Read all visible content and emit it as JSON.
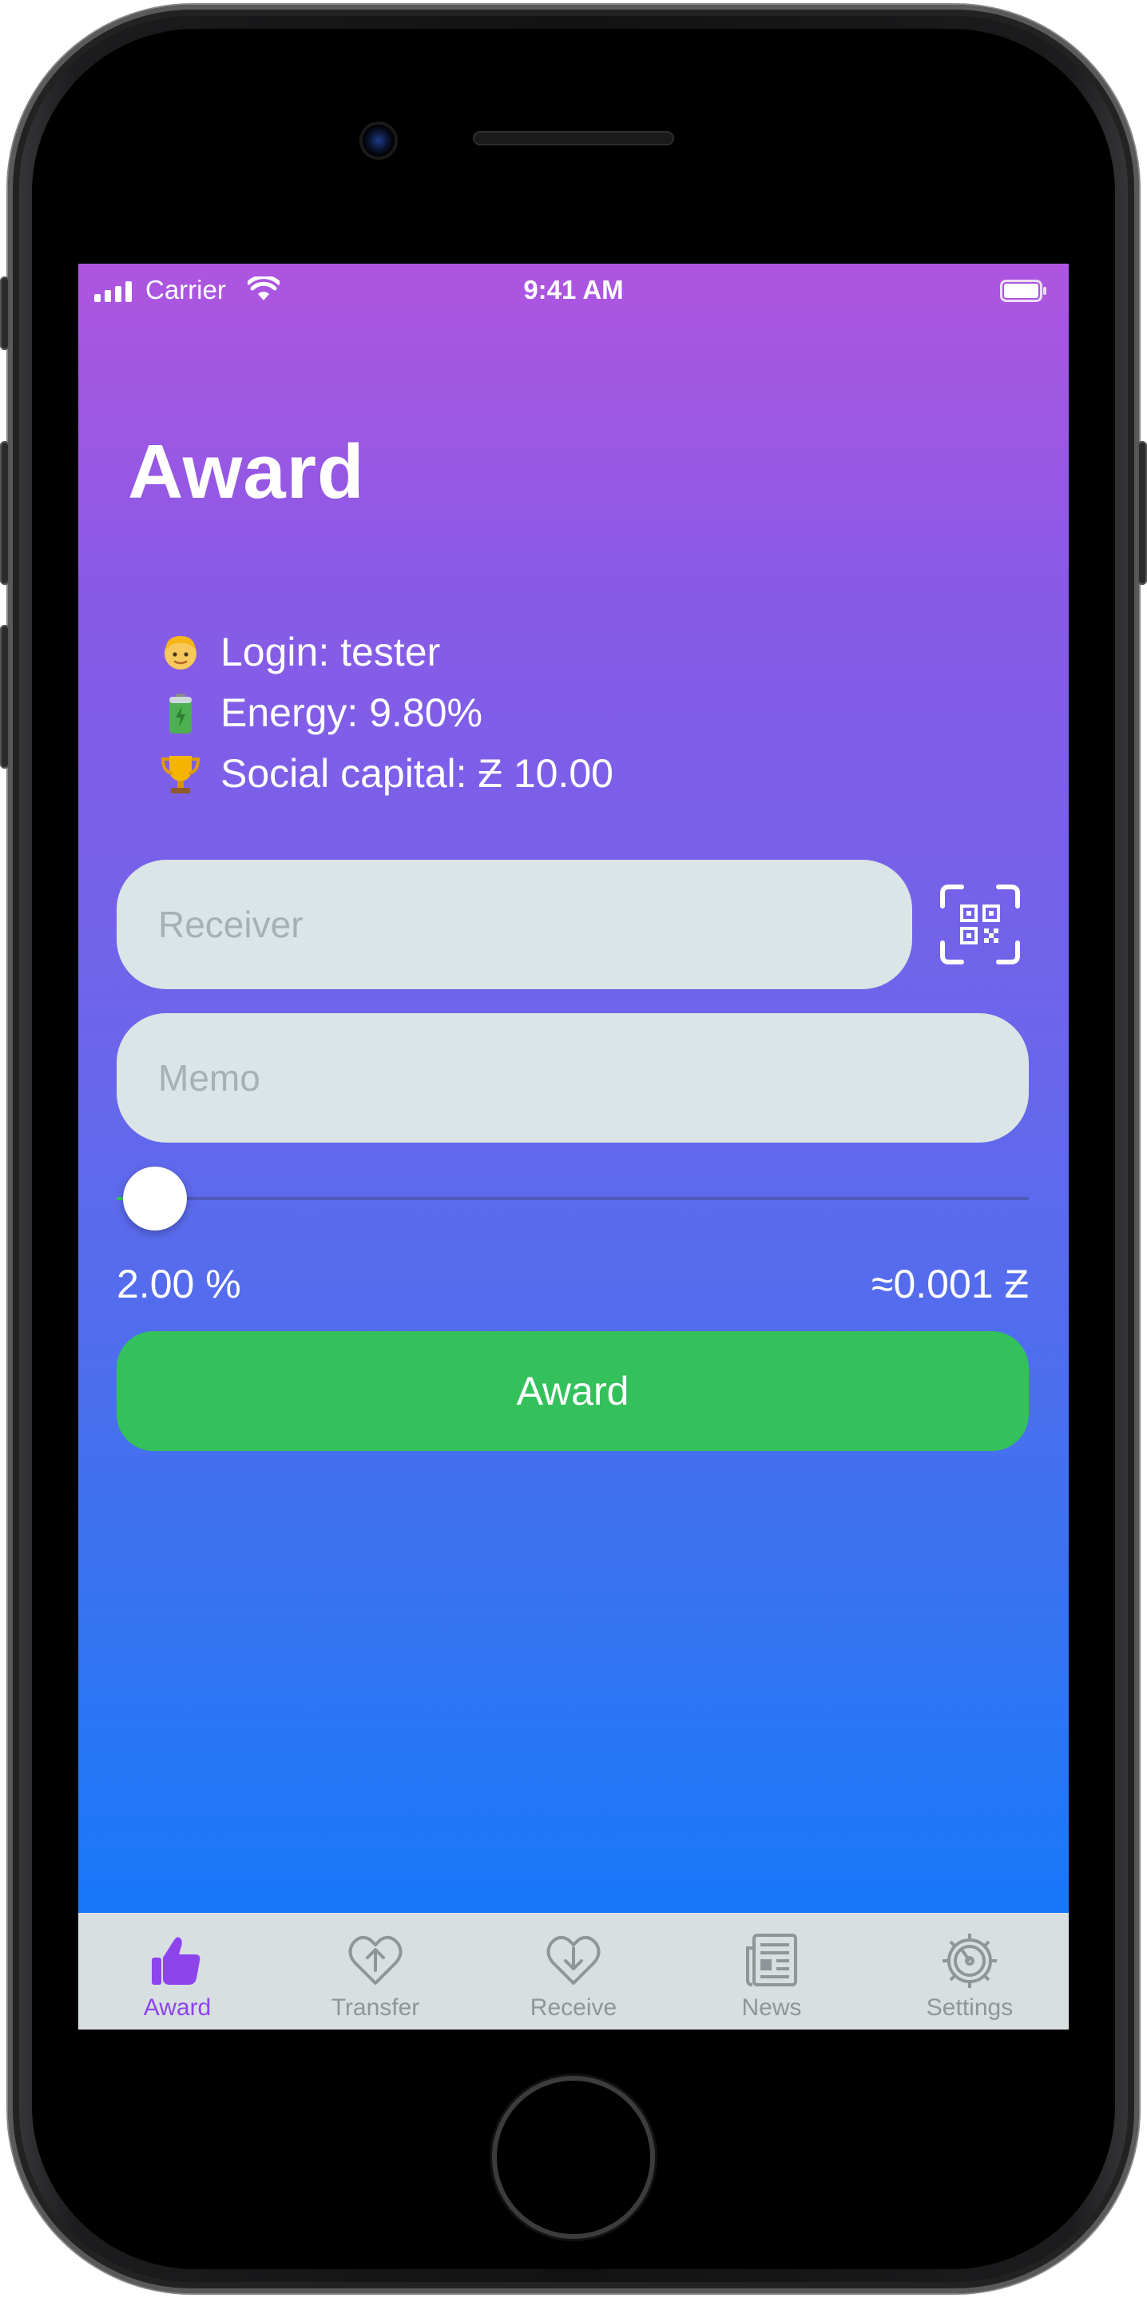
{
  "colors": {
    "gradient_top": "#ae55e0",
    "gradient_bottom": "#0b7bfb",
    "accent_purple": "#8e44ec",
    "award_green": "#34c15c",
    "field_bg": "#dbe4e6",
    "tab_bar_bg": "#d8dfe1",
    "tab_inactive": "#8e9699"
  },
  "status_bar": {
    "carrier": "Carrier",
    "time": "9:41 AM",
    "icons": [
      "signal-icon",
      "wifi-icon",
      "battery-icon"
    ]
  },
  "header": {
    "title": "Award"
  },
  "info": {
    "login": {
      "icon": "person-emoji-icon",
      "text": "Login: tester"
    },
    "energy": {
      "icon": "battery-emoji-icon",
      "text": "Energy: 9.80%"
    },
    "capital": {
      "icon": "trophy-emoji-icon",
      "text": "Social capital: Ƶ 10.00"
    }
  },
  "form": {
    "receiver": {
      "placeholder": "Receiver",
      "value": ""
    },
    "memo": {
      "placeholder": "Memo",
      "value": ""
    },
    "qr_icon": "qr-scan-icon",
    "slider_value": 0.0,
    "percent_text": "2.00 %",
    "approx_text": "≈0.001 Ƶ",
    "submit_label": "Award"
  },
  "tabs": [
    {
      "label": "Award",
      "icon": "thumbs-up-icon",
      "active": true
    },
    {
      "label": "Transfer",
      "icon": "heart-up-icon",
      "active": false
    },
    {
      "label": "Receive",
      "icon": "heart-down-icon",
      "active": false
    },
    {
      "label": "News",
      "icon": "newspaper-icon",
      "active": false
    },
    {
      "label": "Settings",
      "icon": "gear-icon",
      "active": false
    }
  ]
}
